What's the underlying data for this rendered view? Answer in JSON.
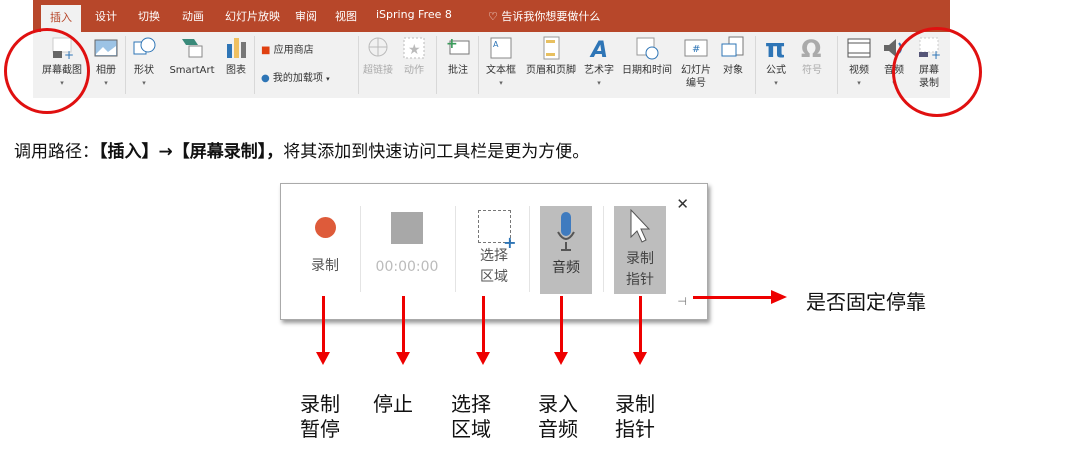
{
  "ribbon": {
    "tabs": [
      "插入",
      "设计",
      "切换",
      "动画",
      "幻灯片放映",
      "审阅",
      "视图",
      "iSpring Free 8"
    ],
    "tell_me": "告诉我你想要做什么",
    "tools": {
      "screenshot": "屏幕截图",
      "album": "相册",
      "shapes": "形状",
      "smartart": "SmartArt",
      "chart": "图表",
      "store": "应用商店",
      "addins": "我的加载项",
      "hyperlink": "超链接",
      "action": "动作",
      "comment": "批注",
      "textbox": "文本框",
      "header_footer": "页眉和页脚",
      "wordart": "艺术字",
      "datetime": "日期和时间",
      "slide_number_1": "幻灯片",
      "slide_number_2": "编号",
      "object": "对象",
      "equation": "公式",
      "symbol": "符号",
      "video": "视频",
      "audio": "音频",
      "screen_rec_1": "屏幕",
      "screen_rec_2": "录制"
    }
  },
  "caption": {
    "prefix": "调用路径：",
    "path": "【插入】→【屏幕录制】，",
    "suffix": "将其添加到快速访问工具栏是更为方便。"
  },
  "dialog": {
    "record": "录制",
    "timer": "00:00:00",
    "select_1": "选择",
    "select_2": "区域",
    "audio": "音频",
    "pointer_1": "录制",
    "pointer_2": "指针",
    "close": "✕"
  },
  "annotations": {
    "record": [
      "录制",
      "暂停"
    ],
    "stop": "停止",
    "select": [
      "选择",
      "区域"
    ],
    "audio": [
      "录入",
      "音频"
    ],
    "pointer": [
      "录制",
      "指针"
    ],
    "dock": "是否固定停靠"
  },
  "colors": {
    "accent": "#b7472a",
    "annotation": "#e00000"
  }
}
